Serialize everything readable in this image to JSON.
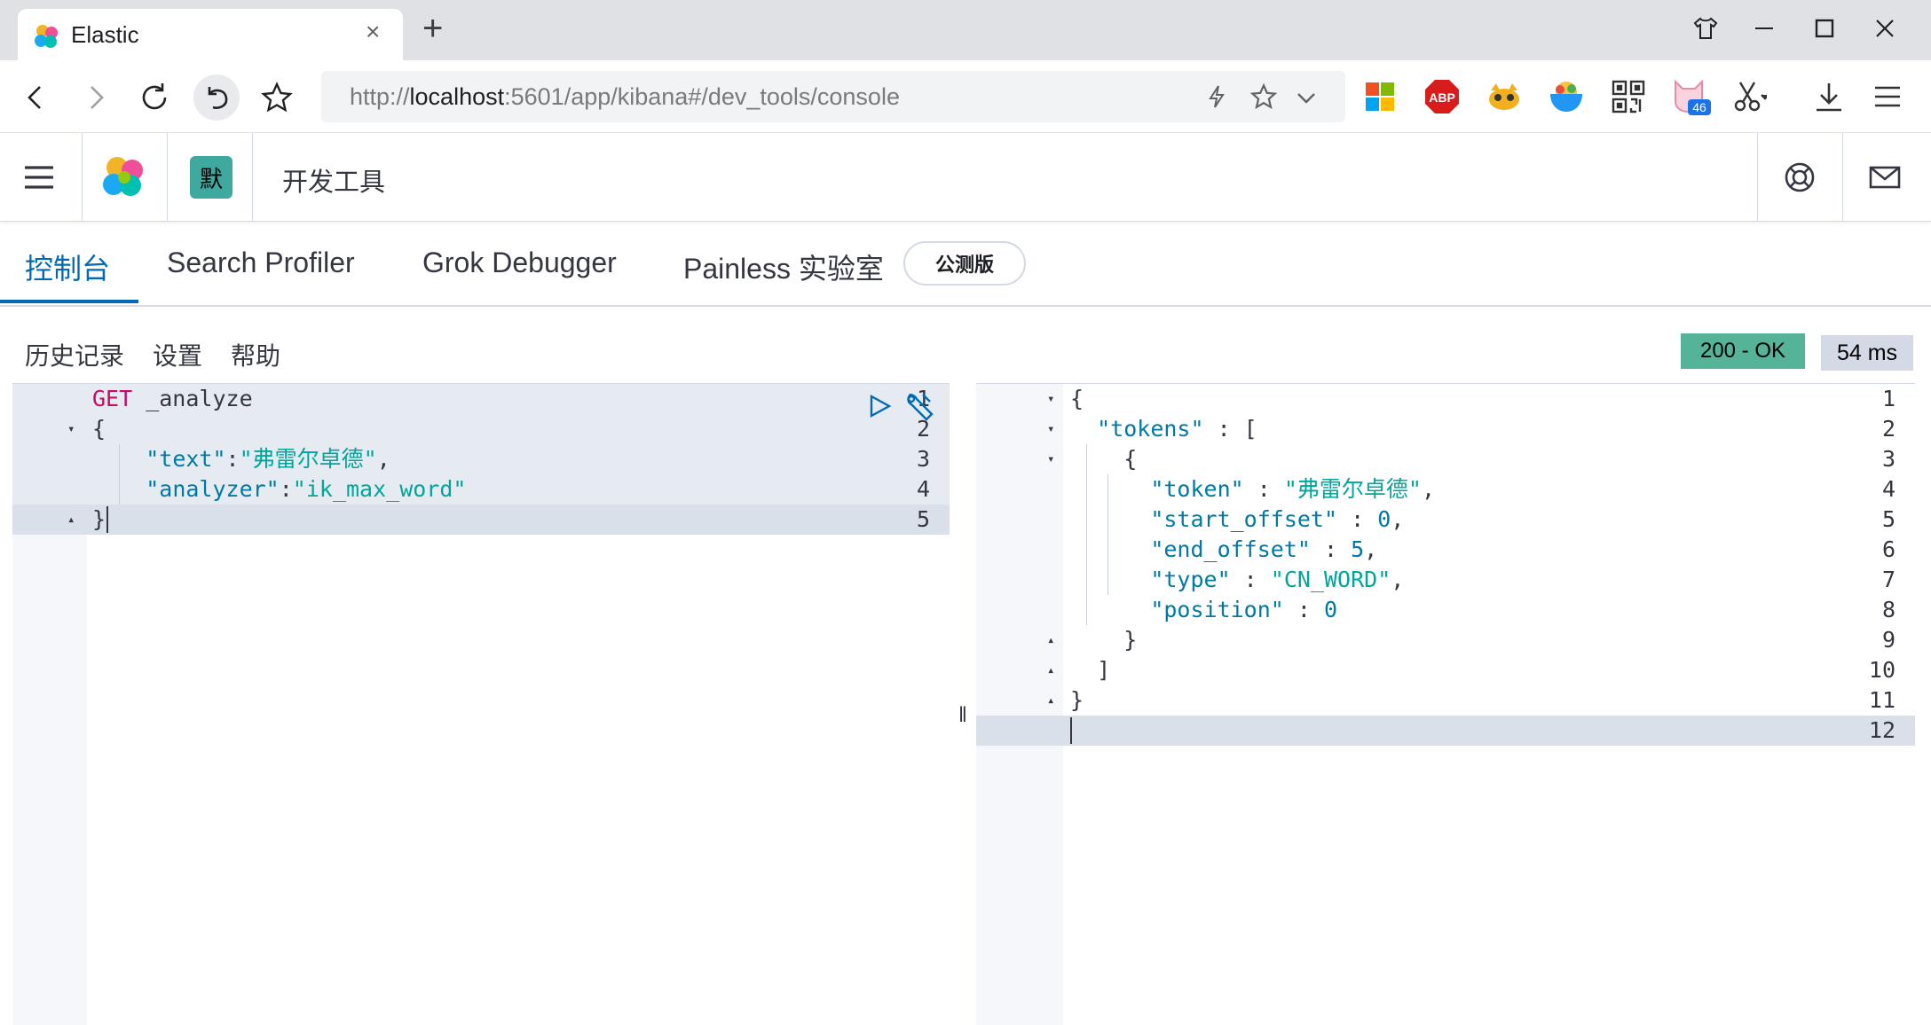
{
  "browser": {
    "tab_title": "Elastic",
    "tab_close": "×",
    "new_tab": "+",
    "url_prefix": "http://",
    "url_host": "localhost",
    "url_rest": ":5601/app/kibana#/dev_tools/console",
    "extensions": [
      "windows-logo-icon",
      "adblock-plus-icon",
      "tampermonkey-icon",
      "bowl-icon",
      "qr-code-icon",
      "cat-badge-icon",
      "scissors-icon",
      "download-icon",
      "menu-icon"
    ],
    "extension_badge": "46",
    "adblock_label": "ABP"
  },
  "kibana_header": {
    "space_initial": "默",
    "app_title": "开发工具",
    "icons": [
      "help-icon",
      "mail-icon"
    ]
  },
  "dev_tabs": [
    {
      "label": "控制台",
      "active": true
    },
    {
      "label": "Search Profiler",
      "active": false
    },
    {
      "label": "Grok Debugger",
      "active": false
    },
    {
      "label": "Painless 实验室",
      "active": false
    }
  ],
  "beta_badge": "公测版",
  "console_menu": [
    "历史记录",
    "设置",
    "帮助"
  ],
  "response_status": "200 - OK",
  "response_time": "54 ms",
  "request_editor": {
    "lines": [
      {
        "n": "1",
        "fold": "",
        "segments": [
          [
            "GET",
            "method"
          ],
          [
            " _analyze",
            "url"
          ]
        ]
      },
      {
        "n": "2",
        "fold": "▾",
        "segments": [
          [
            "{",
            "punc"
          ]
        ]
      },
      {
        "n": "3",
        "fold": "",
        "segments": [
          [
            "    ",
            "punc"
          ],
          [
            "\"text\"",
            "key"
          ],
          [
            ":",
            "punc"
          ],
          [
            "\"弗雷尔卓德\"",
            "str"
          ],
          [
            ",",
            "punc"
          ]
        ]
      },
      {
        "n": "4",
        "fold": "",
        "segments": [
          [
            "    ",
            "punc"
          ],
          [
            "\"analyzer\"",
            "key"
          ],
          [
            ":",
            "punc"
          ],
          [
            "\"ik_max_word\"",
            "str"
          ]
        ]
      },
      {
        "n": "5",
        "fold": "▴",
        "segments": [
          [
            "}",
            "punc"
          ]
        ]
      }
    ]
  },
  "response_editor": {
    "lines": [
      {
        "n": "1",
        "fold": "▾",
        "segments": [
          [
            "{",
            "punc"
          ]
        ]
      },
      {
        "n": "2",
        "fold": "▾",
        "segments": [
          [
            "  ",
            "punc"
          ],
          [
            "\"tokens\"",
            "key"
          ],
          [
            " : [",
            "punc"
          ]
        ]
      },
      {
        "n": "3",
        "fold": "▾",
        "segments": [
          [
            "    {",
            "punc"
          ]
        ]
      },
      {
        "n": "4",
        "fold": "",
        "segments": [
          [
            "      ",
            "punc"
          ],
          [
            "\"token\"",
            "key"
          ],
          [
            " : ",
            "punc"
          ],
          [
            "\"弗雷尔卓德\"",
            "str"
          ],
          [
            ",",
            "punc"
          ]
        ]
      },
      {
        "n": "5",
        "fold": "",
        "segments": [
          [
            "      ",
            "punc"
          ],
          [
            "\"start_offset\"",
            "key"
          ],
          [
            " : ",
            "punc"
          ],
          [
            "0",
            "num"
          ],
          [
            ",",
            "punc"
          ]
        ]
      },
      {
        "n": "6",
        "fold": "",
        "segments": [
          [
            "      ",
            "punc"
          ],
          [
            "\"end_offset\"",
            "key"
          ],
          [
            " : ",
            "punc"
          ],
          [
            "5",
            "num"
          ],
          [
            ",",
            "punc"
          ]
        ]
      },
      {
        "n": "7",
        "fold": "",
        "segments": [
          [
            "      ",
            "punc"
          ],
          [
            "\"type\"",
            "key"
          ],
          [
            " : ",
            "punc"
          ],
          [
            "\"CN_WORD\"",
            "str"
          ],
          [
            ",",
            "punc"
          ]
        ]
      },
      {
        "n": "8",
        "fold": "",
        "segments": [
          [
            "      ",
            "punc"
          ],
          [
            "\"position\"",
            "key"
          ],
          [
            " : ",
            "punc"
          ],
          [
            "0",
            "num"
          ]
        ]
      },
      {
        "n": "9",
        "fold": "▴",
        "segments": [
          [
            "    }",
            "punc"
          ]
        ]
      },
      {
        "n": "10",
        "fold": "▴",
        "segments": [
          [
            "  ]",
            "punc"
          ]
        ]
      },
      {
        "n": "11",
        "fold": "▴",
        "segments": [
          [
            "}",
            "punc"
          ]
        ]
      },
      {
        "n": "12",
        "fold": "",
        "segments": []
      }
    ]
  },
  "resizer_glyph": "‖"
}
